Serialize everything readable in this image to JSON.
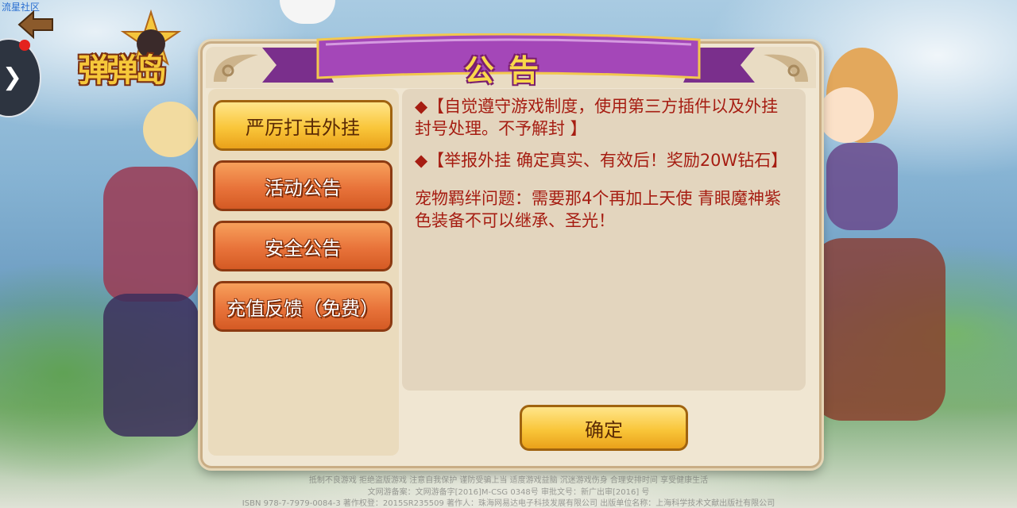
{
  "watermark": "流星社区",
  "logo": {
    "text": "弹弹岛"
  },
  "dialog": {
    "title": "公告",
    "tabs": [
      {
        "label": "严厉打击外挂",
        "style": "yellow",
        "selected": true
      },
      {
        "label": "活动公告",
        "style": "orange",
        "selected": false
      },
      {
        "label": "安全公告",
        "style": "orange",
        "selected": false
      },
      {
        "label": "充值反馈（免费）",
        "style": "orange",
        "selected": false
      }
    ],
    "content": {
      "para1": "◆【自觉遵守游戏制度，使用第三方插件以及外挂封号处理。不予解封 】",
      "para2": "◆【举报外挂 确定真实、有效后！奖励20W钻石】",
      "para3": "宠物羁绊问题：需要那4个再加上天使 青眼魔神紫色装备不可以继承、圣光！"
    },
    "confirm_label": "确定"
  },
  "footer": {
    "line1": "抵制不良游戏 拒绝盗版游戏 注意自我保护 谨防受骗上当 适度游戏益脑 沉迷游戏伤身 合理安排时间 享受健康生活",
    "line2": "文网游备案：文网游备字[2016]M-CSG 0348号 审批文号：新广出审[2016] 号",
    "line3": "ISBN 978-7-7979-0084-3 著作权登：2015SR235509 著作人：珠海网易达电子科技发展有限公司 出版单位名称：上海科学技术文献出版社有限公司"
  },
  "colors": {
    "accent_text": "#a61d12",
    "banner": "#9b3fb0",
    "button_yellow": "#f9c63a",
    "button_orange": "#e8733a"
  },
  "icons": [
    "back-arrow-icon",
    "chevron-right-icon",
    "notification-dot-icon",
    "corner-ornament-icon",
    "banner-ribbon-icon"
  ]
}
